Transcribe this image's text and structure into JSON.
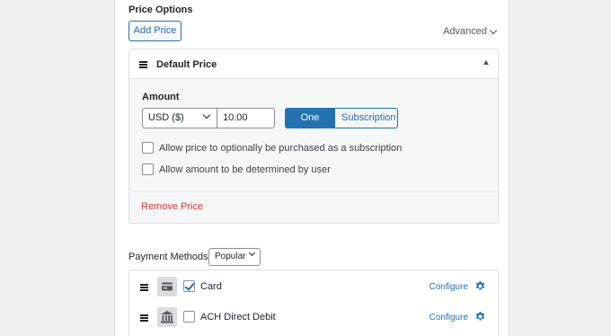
{
  "price_options": {
    "title": "Price Options",
    "add_price_label": "Add Price",
    "advanced_label": "Advanced",
    "default_price": {
      "title": "Default Price",
      "amount_label": "Amount",
      "currency": "USD ($)",
      "amount_value": "10.00",
      "one_time_label": "One time",
      "subscription_label": "Subscription",
      "selected_type": "One time",
      "checkboxes": [
        {
          "label": "Allow price to optionally be purchased as a subscription",
          "checked": false
        },
        {
          "label": "Allow amount to be determined by user",
          "checked": false
        }
      ],
      "remove_label": "Remove Price"
    }
  },
  "payment_methods": {
    "label": "Payment Methods",
    "filter_value": "Popular",
    "items": [
      {
        "name": "Card",
        "checked": true,
        "icon": "credit-card-icon",
        "configure_label": "Configure"
      },
      {
        "name": "ACH Direct Debit",
        "checked": false,
        "icon": "bank-icon",
        "configure_label": "Configure"
      }
    ]
  },
  "colors": {
    "accent": "#2271b1",
    "danger": "#d63638",
    "background": "#f0f0f1"
  }
}
